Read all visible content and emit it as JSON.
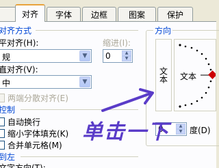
{
  "tabs": [
    {
      "label": "",
      "active": false
    },
    {
      "label": "对齐",
      "active": true
    },
    {
      "label": "字体",
      "active": false
    },
    {
      "label": "边框",
      "active": false
    },
    {
      "label": "图案",
      "active": false
    },
    {
      "label": "保护",
      "active": false
    }
  ],
  "alignment": {
    "group_title": "对齐方式",
    "horizontal_label": "平对齐(H):",
    "horizontal_value": "规",
    "indent_label": "缩进(I):",
    "indent_value": "0",
    "vertical_label": "直对齐(V):",
    "vertical_value": "中",
    "justify_distributed_label": "两端分散对齐(E)"
  },
  "text_control": {
    "group_title": "控制",
    "wrap_text_label": "自动换行",
    "shrink_to_fit_label": "缩小字体填充(K)",
    "merge_cells_label": "合并单元格(M)"
  },
  "direction": {
    "group_title": "到左",
    "text_direction_label": "文字方向(T):"
  },
  "orientation": {
    "group_title": "方向",
    "vertical_text": "文本",
    "dial_text": "文本",
    "degrees_value": "0",
    "degrees_label": "度(D)",
    "marker_color": "#cc0000"
  },
  "annotation": {
    "text": "单击一下",
    "color": "#5a3cc8"
  }
}
